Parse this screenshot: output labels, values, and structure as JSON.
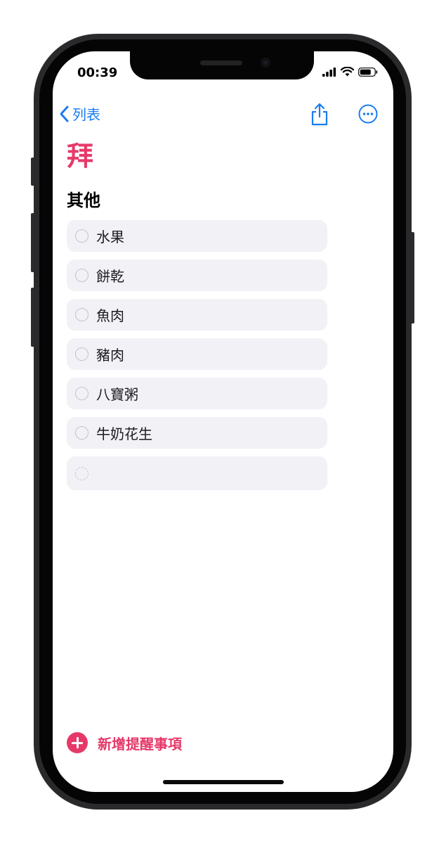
{
  "status_bar": {
    "time": "00:39"
  },
  "nav": {
    "back_label": "列表",
    "share_icon": "share-icon",
    "more_icon": "ellipsis-circle-icon"
  },
  "list": {
    "title": "拜",
    "accent_color": "#e6396a"
  },
  "section": {
    "title": "其他"
  },
  "reminders": [
    {
      "label": "水果"
    },
    {
      "label": "餅乾"
    },
    {
      "label": "魚肉"
    },
    {
      "label": "豬肉"
    },
    {
      "label": "八寶粥"
    },
    {
      "label": "牛奶花生"
    },
    {
      "label": ""
    }
  ],
  "footer": {
    "add_label": "新增提醒事項"
  },
  "colors": {
    "link": "#1a7cf2",
    "row_bg": "#f1f1f6"
  }
}
